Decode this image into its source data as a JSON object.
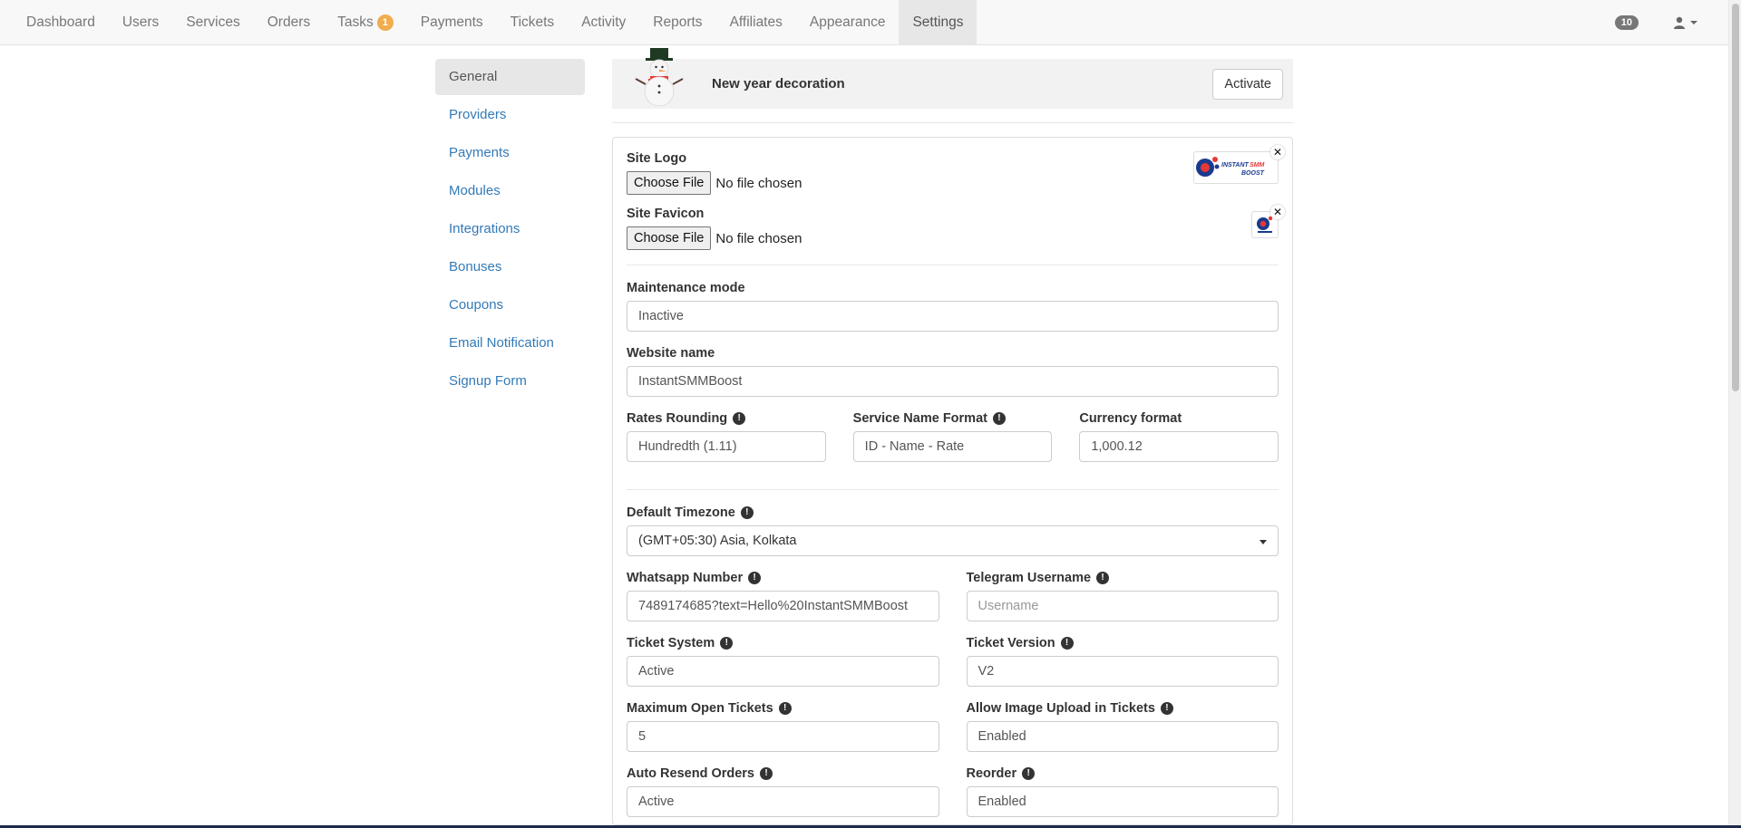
{
  "nav": {
    "items": [
      {
        "label": "Dashboard"
      },
      {
        "label": "Users"
      },
      {
        "label": "Services"
      },
      {
        "label": "Orders"
      },
      {
        "label": "Tasks",
        "badge": "1"
      },
      {
        "label": "Payments"
      },
      {
        "label": "Tickets"
      },
      {
        "label": "Activity"
      },
      {
        "label": "Reports"
      },
      {
        "label": "Affiliates"
      },
      {
        "label": "Appearance"
      },
      {
        "label": "Settings",
        "active": true
      }
    ],
    "count_badge": "10",
    "user_icon": "user-icon"
  },
  "sidebar": {
    "items": [
      {
        "label": "General",
        "active": true
      },
      {
        "label": "Providers"
      },
      {
        "label": "Payments"
      },
      {
        "label": "Modules"
      },
      {
        "label": "Integrations"
      },
      {
        "label": "Bonuses"
      },
      {
        "label": "Coupons"
      },
      {
        "label": "Email Notification"
      },
      {
        "label": "Signup Form"
      }
    ]
  },
  "decoration": {
    "title": "New year decoration",
    "button": "Activate",
    "icon": "snowman-icon"
  },
  "form": {
    "site_logo": {
      "label": "Site Logo",
      "button": "Choose File",
      "status": "No file chosen",
      "logo_text": [
        "INSTANT SMM",
        "BOOST"
      ]
    },
    "site_favicon": {
      "label": "Site Favicon",
      "button": "Choose File",
      "status": "No file chosen"
    },
    "maintenance": {
      "label": "Maintenance mode",
      "value": "Inactive"
    },
    "website_name": {
      "label": "Website name",
      "value": "InstantSMMBoost"
    },
    "rates_rounding": {
      "label": "Rates Rounding",
      "value": "Hundredth (1.11)"
    },
    "service_name_format": {
      "label": "Service Name Format",
      "value": "ID - Name - Rate"
    },
    "currency_format": {
      "label": "Currency format",
      "value": "1,000.12"
    },
    "timezone": {
      "label": "Default Timezone",
      "value": "(GMT+05:30) Asia, Kolkata"
    },
    "whatsapp": {
      "label": "Whatsapp Number",
      "value": "7489174685?text=Hello%20InstantSMMBoost"
    },
    "telegram": {
      "label": "Telegram Username",
      "placeholder": "Username"
    },
    "ticket_system": {
      "label": "Ticket System",
      "value": "Active"
    },
    "ticket_version": {
      "label": "Ticket Version",
      "value": "V2"
    },
    "max_open_tickets": {
      "label": "Maximum Open Tickets",
      "value": "5"
    },
    "image_upload": {
      "label": "Allow Image Upload in Tickets",
      "value": "Enabled"
    },
    "auto_resend": {
      "label": "Auto Resend Orders",
      "value": "Active"
    },
    "reorder": {
      "label": "Reorder",
      "value": "Enabled"
    }
  },
  "colors": {
    "link": "#337ab7",
    "badge_tasks": "#f0ad4e",
    "badge_count": "#777777"
  }
}
